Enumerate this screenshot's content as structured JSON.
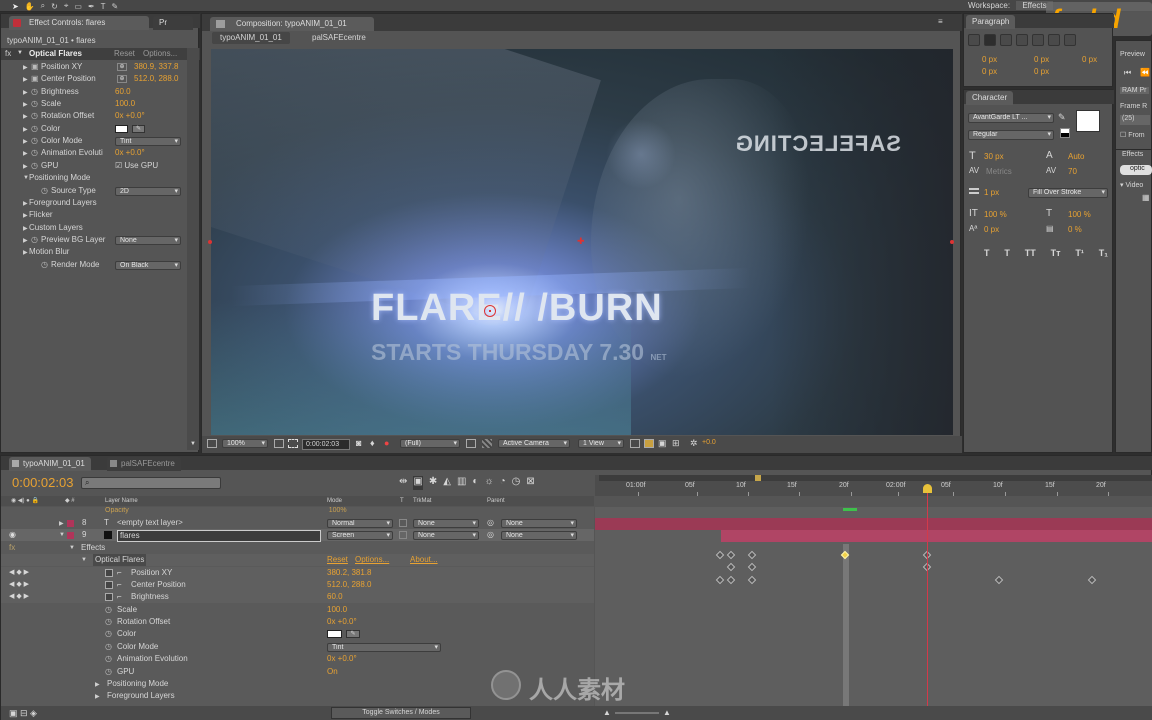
{
  "menubar": {
    "workspace_label": "Workspace:",
    "workspace_value": "Effects",
    "watermark": "fxphd"
  },
  "effect_controls": {
    "tab": "Effect Controls: flares",
    "tab2": "Pr",
    "subject": "typoANIM_01_01 • flares",
    "effect": "Optical Flares",
    "reset": "Reset",
    "options": "Options...",
    "rows": [
      {
        "label": "Position XY",
        "value": "380.9, 337.8",
        "kind": "point"
      },
      {
        "label": "Center Position",
        "value": "512.0, 288.0",
        "kind": "point"
      },
      {
        "label": "Brightness",
        "value": "60.0",
        "kind": "num"
      },
      {
        "label": "Scale",
        "value": "100.0",
        "kind": "num"
      },
      {
        "label": "Rotation Offset",
        "value": "0x +0.0°",
        "kind": "num"
      },
      {
        "label": "Color",
        "value": "",
        "kind": "color"
      },
      {
        "label": "Color Mode",
        "value": "Tint",
        "kind": "select"
      },
      {
        "label": "Animation Evoluti",
        "value": "0x +0.0°",
        "kind": "num"
      },
      {
        "label": "GPU",
        "value": "Use GPU",
        "kind": "check"
      },
      {
        "label": "Positioning Mode",
        "value": "",
        "kind": "group"
      },
      {
        "label": "Source Type",
        "value": "2D",
        "kind": "select"
      },
      {
        "label": "Foreground Layers",
        "value": "",
        "kind": "group"
      },
      {
        "label": "Flicker",
        "value": "",
        "kind": "group"
      },
      {
        "label": "Custom Layers",
        "value": "",
        "kind": "group"
      },
      {
        "label": "Preview BG Layer",
        "value": "None",
        "kind": "select"
      },
      {
        "label": "Motion Blur",
        "value": "",
        "kind": "group"
      },
      {
        "label": "Render Mode",
        "value": "On Black",
        "kind": "select"
      }
    ]
  },
  "composition": {
    "tab": "Composition: typoANIM_01_01",
    "crumb1": "typoANIM_01_01",
    "crumb2": "palSAFEcentre",
    "viewer": {
      "title": "FLARE//  /BURN",
      "subtitle": "STARTS THURSDAY 7.30",
      "subtitle_small": "NET",
      "mirror": "SAFELECTING"
    },
    "footer": {
      "zoom": "100%",
      "time": "0:00:02:03",
      "resolution": "(Full)",
      "camera": "Active Camera",
      "views": "1 View",
      "exposure": "+0.0"
    }
  },
  "paragraph": {
    "tab": "Paragraph",
    "fields": [
      "0 px",
      "0 px",
      "0 px",
      "0 px",
      "0 px"
    ]
  },
  "character": {
    "tab": "Character",
    "font": "AvantGarde LT ...",
    "style": "Regular",
    "size": "30 px",
    "leading": "Auto",
    "kerning": "Metrics",
    "tracking": "70",
    "stroke": "1 px",
    "stroke_mode": "Fill Over Stroke",
    "vscale": "100 %",
    "hscale": "100 %",
    "baseline": "0 px",
    "tsume": "0 %",
    "styles": [
      "T",
      "T",
      "TT",
      "Tт",
      "T¹",
      "T₁"
    ]
  },
  "right": {
    "preview": "Preview",
    "ram": "RAM Pr",
    "framerate_label": "Frame R",
    "framerate": "(25)",
    "from": "From",
    "effects": "Effects",
    "search": "optic",
    "video": "Video"
  },
  "timeline": {
    "tabs": [
      "typoANIM_01_01",
      "palSAFEcentre"
    ],
    "time": "0:00:02:03",
    "search": "",
    "headers": {
      "layer_name": "Layer Name",
      "mode": "Mode",
      "t": "T",
      "trkmat": "TrkMat",
      "parent": "Parent"
    },
    "ruler": [
      "01:00f",
      "05f",
      "10f",
      "15f",
      "20f",
      "02:00f",
      "05f",
      "10f",
      "15f",
      "20f"
    ],
    "layers": [
      {
        "num": "8",
        "name": "<empty text layer>",
        "mode": "Normal",
        "trkmat": "None",
        "parent": "None"
      },
      {
        "num": "9",
        "name": "flares",
        "mode": "Screen",
        "trkmat": "None",
        "parent": "None"
      }
    ],
    "opacity_row": {
      "label": "Opacity",
      "value": "100%"
    },
    "props": [
      {
        "label": "Effects",
        "value": ""
      },
      {
        "label": "Optical Flares",
        "value": "Reset",
        "value2": "Options...",
        "value3": "About..."
      },
      {
        "label": "Position XY",
        "value": "380.2, 381.8"
      },
      {
        "label": "Center Position",
        "value": "512.0, 288.0"
      },
      {
        "label": "Brightness",
        "value": "60.0"
      },
      {
        "label": "Scale",
        "value": "100.0"
      },
      {
        "label": "Rotation Offset",
        "value": "0x +0.0°"
      },
      {
        "label": "Color",
        "value": ""
      },
      {
        "label": "Color Mode",
        "value": "Tint"
      },
      {
        "label": "Animation Evolution",
        "value": "0x +0.0°"
      },
      {
        "label": "GPU",
        "value": "On"
      },
      {
        "label": "Positioning Mode",
        "value": ""
      },
      {
        "label": "Foreground Layers",
        "value": ""
      }
    ],
    "toggle": "Toggle Switches / Modes"
  },
  "colors": {
    "accent": "#e8a232",
    "layer_bar": "#9b3a55",
    "cti": "#d33a4a",
    "panel": "#535353"
  },
  "watermark_cn": "人人素材"
}
